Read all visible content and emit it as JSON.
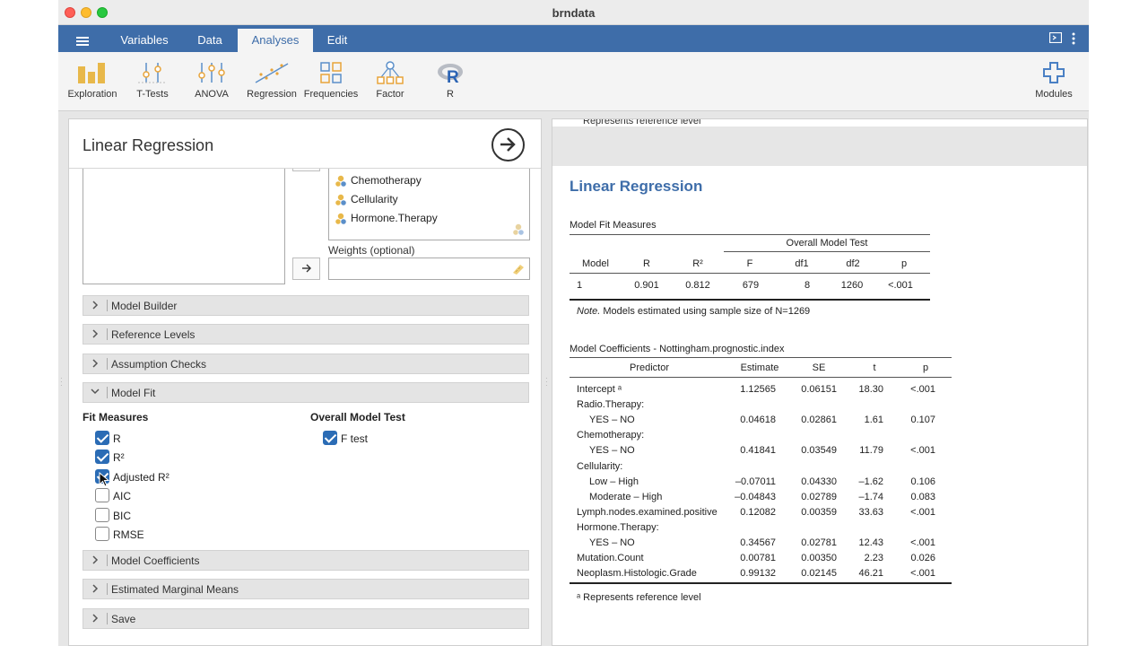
{
  "window": {
    "title": "brndata"
  },
  "menu": {
    "tabs": [
      "Variables",
      "Data",
      "Analyses",
      "Edit"
    ]
  },
  "toolbar": {
    "items": [
      "Exploration",
      "T-Tests",
      "ANOVA",
      "Regression",
      "Frequencies",
      "Factor",
      "R"
    ],
    "modules": "Modules"
  },
  "options": {
    "title": "Linear Regression",
    "variables": [
      "Chemotherapy",
      "Cellularity",
      "Hormone.Therapy"
    ],
    "weights_label": "Weights (optional)",
    "sections": [
      "Model Builder",
      "Reference Levels",
      "Assumption Checks",
      "Model Fit",
      "Model Coefficients",
      "Estimated Marginal Means",
      "Save"
    ],
    "fit_measures_title": "Fit Measures",
    "fit_measures": [
      {
        "label": "R",
        "checked": true
      },
      {
        "label": "R²",
        "checked": true
      },
      {
        "label": "Adjusted R²",
        "checked": true
      },
      {
        "label": "AIC",
        "checked": false
      },
      {
        "label": "BIC",
        "checked": false
      },
      {
        "label": "RMSE",
        "checked": false
      }
    ],
    "overall_title": "Overall Model Test",
    "overall": [
      {
        "label": "F test",
        "checked": true
      }
    ]
  },
  "results": {
    "top_note": "Represents reference level",
    "title": "Linear Regression",
    "fit": {
      "title": "Model Fit Measures",
      "group_header": "Overall Model Test",
      "headers": [
        "Model",
        "R",
        "R²",
        "F",
        "df1",
        "df2",
        "p"
      ],
      "row": [
        "1",
        "0.901",
        "0.812",
        "679",
        "8",
        "1260",
        "<.001"
      ],
      "note_italic": "Note.",
      "note": "Models estimated using sample size of N=1269"
    },
    "coef": {
      "title": "Model Coefficients - Nottingham.prognostic.index",
      "headers": [
        "Predictor",
        "Estimate",
        "SE",
        "t",
        "p"
      ],
      "rows": [
        {
          "name": "Intercept ᵃ",
          "indent": false,
          "est": "1.12565",
          "se": "0.06151",
          "t": "18.30",
          "p": "<.001"
        },
        {
          "name": "Radio.Therapy:",
          "indent": false,
          "est": "",
          "se": "",
          "t": "",
          "p": ""
        },
        {
          "name": "YES – NO",
          "indent": true,
          "est": "0.04618",
          "se": "0.02861",
          "t": "1.61",
          "p": "0.107"
        },
        {
          "name": "Chemotherapy:",
          "indent": false,
          "est": "",
          "se": "",
          "t": "",
          "p": ""
        },
        {
          "name": "YES – NO",
          "indent": true,
          "est": "0.41841",
          "se": "0.03549",
          "t": "11.79",
          "p": "<.001"
        },
        {
          "name": "Cellularity:",
          "indent": false,
          "est": "",
          "se": "",
          "t": "",
          "p": ""
        },
        {
          "name": "Low – High",
          "indent": true,
          "est": "–0.07011",
          "se": "0.04330",
          "t": "–1.62",
          "p": "0.106"
        },
        {
          "name": "Moderate – High",
          "indent": true,
          "est": "–0.04843",
          "se": "0.02789",
          "t": "–1.74",
          "p": "0.083"
        },
        {
          "name": "Lymph.nodes.examined.positive",
          "indent": false,
          "est": "0.12082",
          "se": "0.00359",
          "t": "33.63",
          "p": "<.001"
        },
        {
          "name": "Hormone.Therapy:",
          "indent": false,
          "est": "",
          "se": "",
          "t": "",
          "p": ""
        },
        {
          "name": "YES – NO",
          "indent": true,
          "est": "0.34567",
          "se": "0.02781",
          "t": "12.43",
          "p": "<.001"
        },
        {
          "name": "Mutation.Count",
          "indent": false,
          "est": "0.00781",
          "se": "0.00350",
          "t": "2.23",
          "p": "0.026"
        },
        {
          "name": "Neoplasm.Histologic.Grade",
          "indent": false,
          "est": "0.99132",
          "se": "0.02145",
          "t": "46.21",
          "p": "<.001"
        }
      ],
      "footnote": "ᵃ Represents reference level"
    }
  }
}
